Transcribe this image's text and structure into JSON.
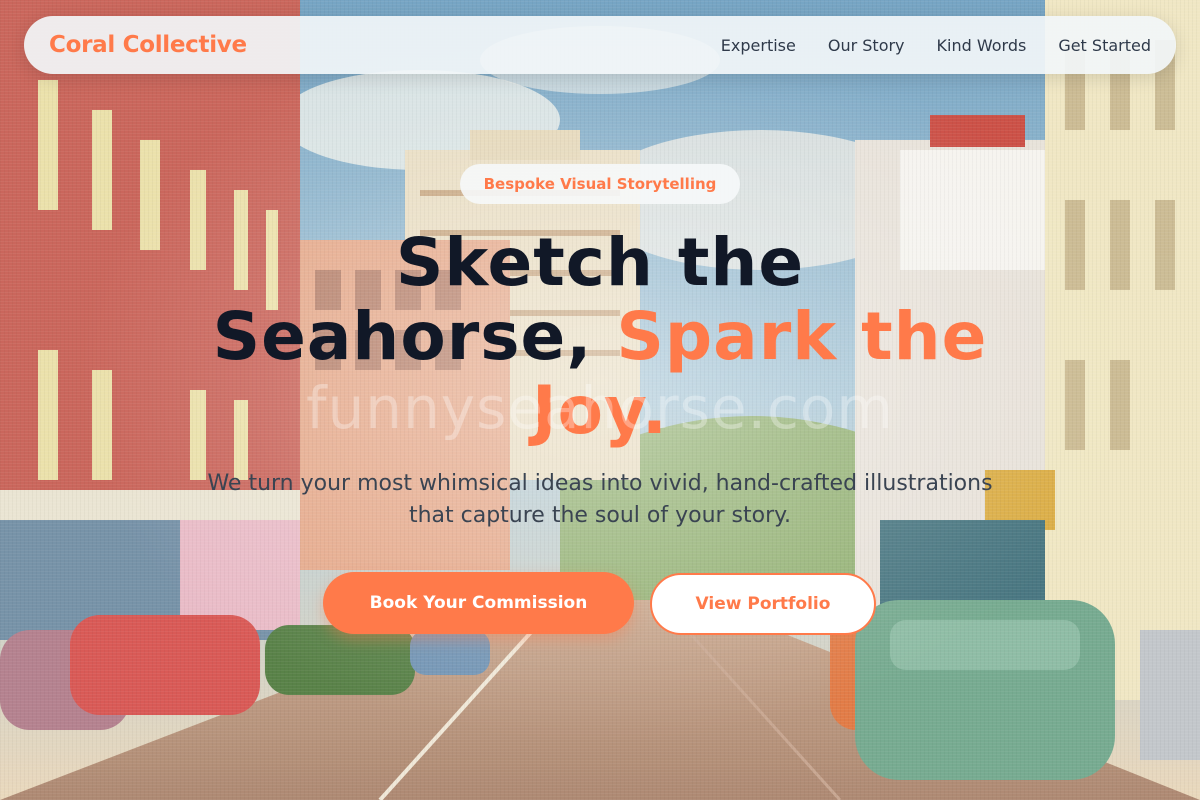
{
  "brand": {
    "name": "Coral Collective"
  },
  "nav": {
    "links": [
      {
        "label": "Expertise"
      },
      {
        "label": "Our Story"
      },
      {
        "label": "Kind Words"
      },
      {
        "label": "Get Started"
      }
    ]
  },
  "hero": {
    "tag": "Bespoke Visual Storytelling",
    "headline_line1": "Sketch the",
    "headline_line2_dark": "Seahorse, ",
    "headline_line2_accent": "Spark the",
    "headline_line3_accent": "Joy.",
    "watermark": "funnyseahorse.com",
    "subheading_line1": "We turn your most whimsical ideas into vivid, hand-crafted illustrations",
    "subheading_line2": "that capture the soul of your story.",
    "primary_cta": "Book Your Commission",
    "secondary_cta": "View Portfolio"
  },
  "background": {
    "description_icon": "vintage-street-scene-image"
  },
  "colors": {
    "accent": "#ff7a4a",
    "heading": "#111827",
    "body_text": "#3a4452",
    "nav_text": "#2f3a4a",
    "navbar_bg": "#f2f6f8"
  }
}
